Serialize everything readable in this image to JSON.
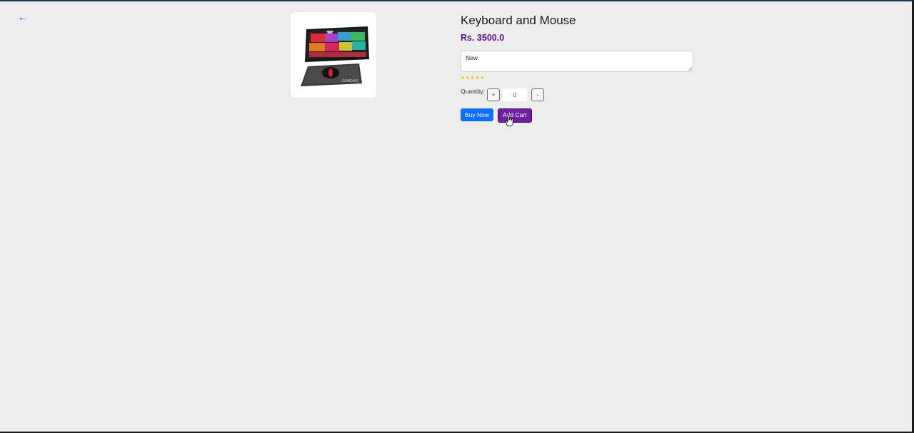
{
  "nav": {
    "back_label": "←"
  },
  "product": {
    "title": "Keyboard and Mouse",
    "price": "Rs. 3500.0",
    "condition": "New",
    "rating_stars": "★★★★★",
    "rating": 5,
    "image_alt": "keyboard-and-mouse-product-image"
  },
  "quantity": {
    "label": "Quantity:",
    "increment_label": "+",
    "value": "0",
    "decrement_label": "-"
  },
  "actions": {
    "buy_now_label": "Buy Now",
    "add_cart_label": "Add Cart"
  },
  "colors": {
    "background": "#ededed",
    "price": "#5b0f8f",
    "buy_now": "#0d6efd",
    "add_cart": "#6f1fa0",
    "stars": "#f2c200",
    "back_link": "#8a2be2"
  }
}
